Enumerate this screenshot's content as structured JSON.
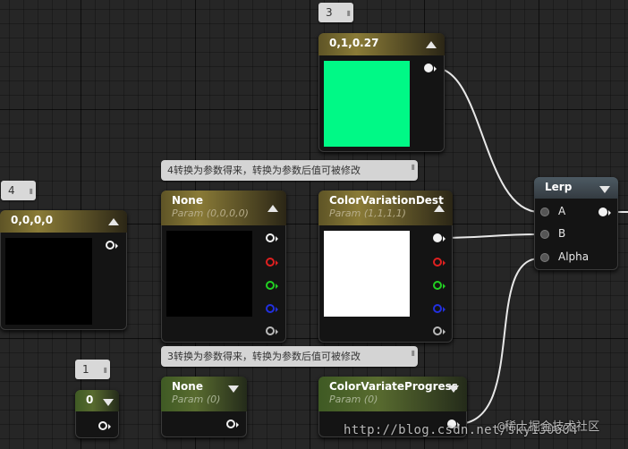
{
  "nodes": {
    "const3": {
      "badge": "3",
      "title": "0,1,0.27",
      "swatch_color": "#00F986"
    },
    "const4": {
      "badge": "4",
      "title": "0,0,0,0",
      "swatch_color": "#000000"
    },
    "param_none_vec": {
      "title": "None",
      "subtitle": "Param (0,0,0,0)",
      "swatch_color": "#000000"
    },
    "color_variation_dest": {
      "title": "ColorVariationDest",
      "subtitle": "Param (1,1,1,1)",
      "swatch_color": "#FFFFFF"
    },
    "lerp": {
      "title": "Lerp",
      "inputs": [
        "A",
        "B",
        "Alpha"
      ]
    },
    "const1": {
      "badge": "1",
      "title": "0"
    },
    "param_none_scalar": {
      "title": "None",
      "subtitle": "Param (0)"
    },
    "color_variate_progress": {
      "title": "ColorVariateProgress",
      "subtitle": "Param (0)"
    }
  },
  "comments": {
    "vector_param_note": "4转换为参数得来，转换为参数后值可被修改",
    "scalar_param_note": "3转换为参数得来，转换为参数后值可被修改"
  },
  "watermark": {
    "url": "http://blog.csdn.net/sky130604",
    "site": "@稀土掘金技术社区"
  },
  "colors": {
    "canvas": "#262626",
    "vector_header": "#8A7B37",
    "scalar_header": "#586B2F",
    "lerp_header": "#4D5A63",
    "pin_red": "#E02020",
    "pin_green": "#22D022",
    "pin_blue": "#2230E0"
  }
}
